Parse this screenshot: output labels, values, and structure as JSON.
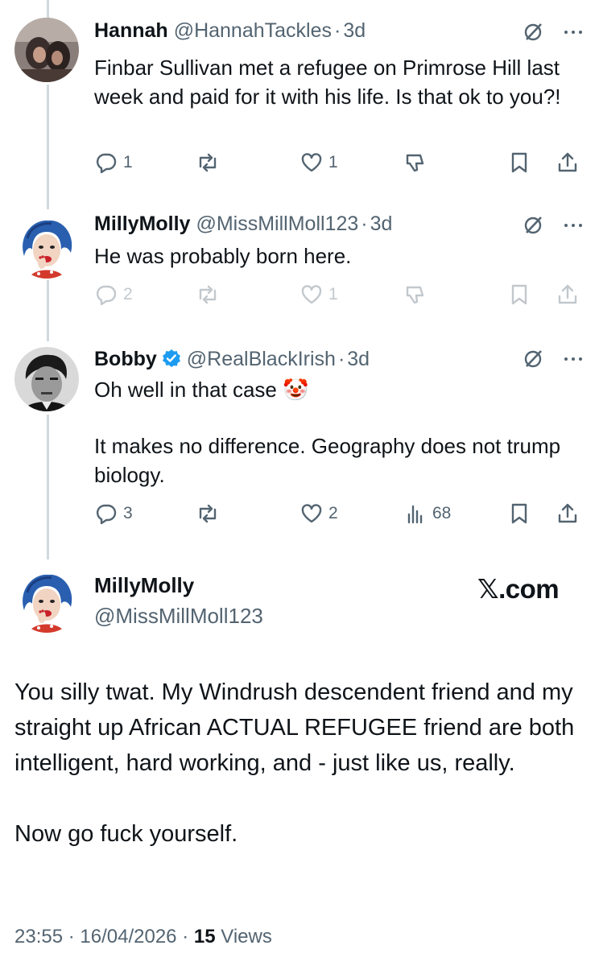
{
  "tweets": [
    {
      "name": "Hannah",
      "handle": "@HannahTackles",
      "time": "3d",
      "text": [
        "Finbar Sullivan met a refugee on Primrose Hill last week and paid for it with his life. Is that ok to you?!"
      ],
      "replies": "1",
      "reposts": "",
      "likes": "1",
      "views": "",
      "faded": false
    },
    {
      "name": "MillyMolly",
      "handle": "@MissMillMoll123",
      "time": "3d",
      "text": [
        "He was probably born here."
      ],
      "replies": "2",
      "reposts": "",
      "likes": "1",
      "views": "",
      "faded": true
    },
    {
      "name": "Bobby",
      "handle": "@RealBlackIrish",
      "time": "3d",
      "text": [
        "Oh well in that case 🤡",
        "It makes no difference. Geography does not trump biology."
      ],
      "replies": "3",
      "reposts": "",
      "likes": "2",
      "views": "68",
      "verified": true,
      "faded": false
    }
  ],
  "main": {
    "name": "MillyMolly",
    "handle": "@MissMillMoll123",
    "brand": "𝕏.com",
    "text": [
      "You silly twat. My Windrush descendent friend and my straight up African ACTUAL REFUGEE friend are both intelligent, hard working, and - just like us, really.",
      "Now go fuck yourself."
    ],
    "time": "23:55",
    "date": "16/04/2026",
    "views_count": "15",
    "views_label": "Views"
  },
  "colors": {
    "text": "#0f1419",
    "muted": "#536471",
    "verified": "#1d9bf0",
    "thread_line": "#cfd9de"
  },
  "icons": [
    "grok-icon",
    "more-icon",
    "reply-icon",
    "repost-icon",
    "like-icon",
    "views-icon",
    "bookmark-icon",
    "share-icon",
    "verified-badge-icon",
    "clown-emoji"
  ]
}
